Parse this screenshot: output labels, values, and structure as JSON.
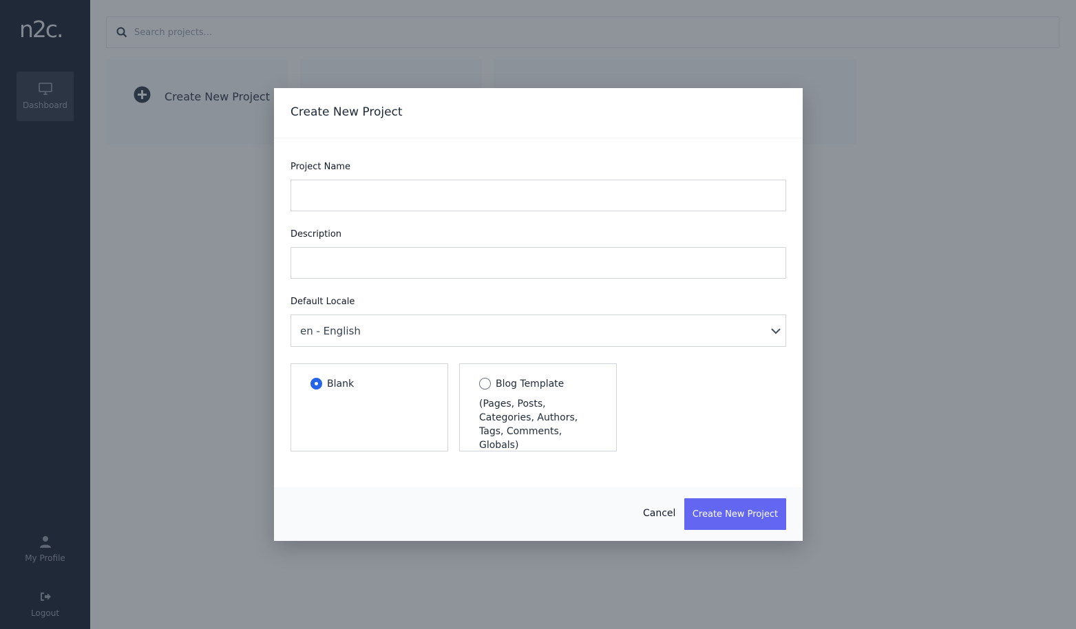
{
  "app": {
    "logo_text": "n2c."
  },
  "sidebar": {
    "items": [
      {
        "label": "Dashboard",
        "icon": "monitor-icon",
        "active": true
      },
      {
        "label": "My Profile",
        "icon": "user-icon"
      },
      {
        "label": "Logout",
        "icon": "sign-out-icon"
      }
    ]
  },
  "search": {
    "placeholder": "Search projects..."
  },
  "projects": {
    "create_card_label": "Create New Project"
  },
  "modal": {
    "title": "Create New Project",
    "project_name_label": "Project Name",
    "project_name_value": "",
    "description_label": "Description",
    "description_value": "",
    "locale_label": "Default Locale",
    "locale_value": "en - English",
    "templates": [
      {
        "label": "Blank",
        "selected": true,
        "description": ""
      },
      {
        "label": "Blog Template",
        "selected": false,
        "description": "(Pages, Posts, Categories, Authors, Tags, Comments, Globals)"
      }
    ],
    "cancel_label": "Cancel",
    "submit_label": "Create New Project"
  },
  "colors": {
    "sidebar_bg": "#1f2937",
    "primary_button": "#6366f1",
    "radio_selected": "#2563eb"
  }
}
